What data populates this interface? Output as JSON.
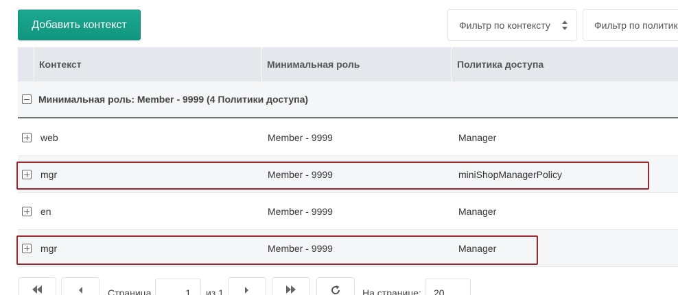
{
  "toolbar": {
    "add_context_label": "Добавить контекст",
    "filter_context_placeholder": "Фильтр по контексту",
    "filter_policy_placeholder": "Фильтр по политике"
  },
  "grid": {
    "columns": [
      "Контекст",
      "Минимальная роль",
      "Политика доступа"
    ],
    "group": {
      "label": "Минимальная роль: Member - 9999 (4 Политики доступа)"
    },
    "rows": [
      {
        "context": "web",
        "role": "Member - 9999",
        "policy": "Manager"
      },
      {
        "context": "mgr",
        "role": "Member - 9999",
        "policy": "miniShopManagerPolicy"
      },
      {
        "context": "en",
        "role": "Member - 9999",
        "policy": "Manager"
      },
      {
        "context": "mgr",
        "role": "Member - 9999",
        "policy": "Manager"
      }
    ]
  },
  "pager": {
    "page_label": "Страница",
    "page_value": "1",
    "of_label": "из 1",
    "per_page_label": "На странице:",
    "per_page_value": "20"
  },
  "colors": {
    "accent": "#14a086",
    "highlight": "#a2262b",
    "header_bg": "#e4e8ec",
    "alt_row_bg": "#f4f6f8"
  },
  "icons": [
    "sort-updown-icon",
    "collapse-icon",
    "expand-icon",
    "first-page-icon",
    "prev-page-icon",
    "next-page-icon",
    "last-page-icon",
    "refresh-icon"
  ]
}
